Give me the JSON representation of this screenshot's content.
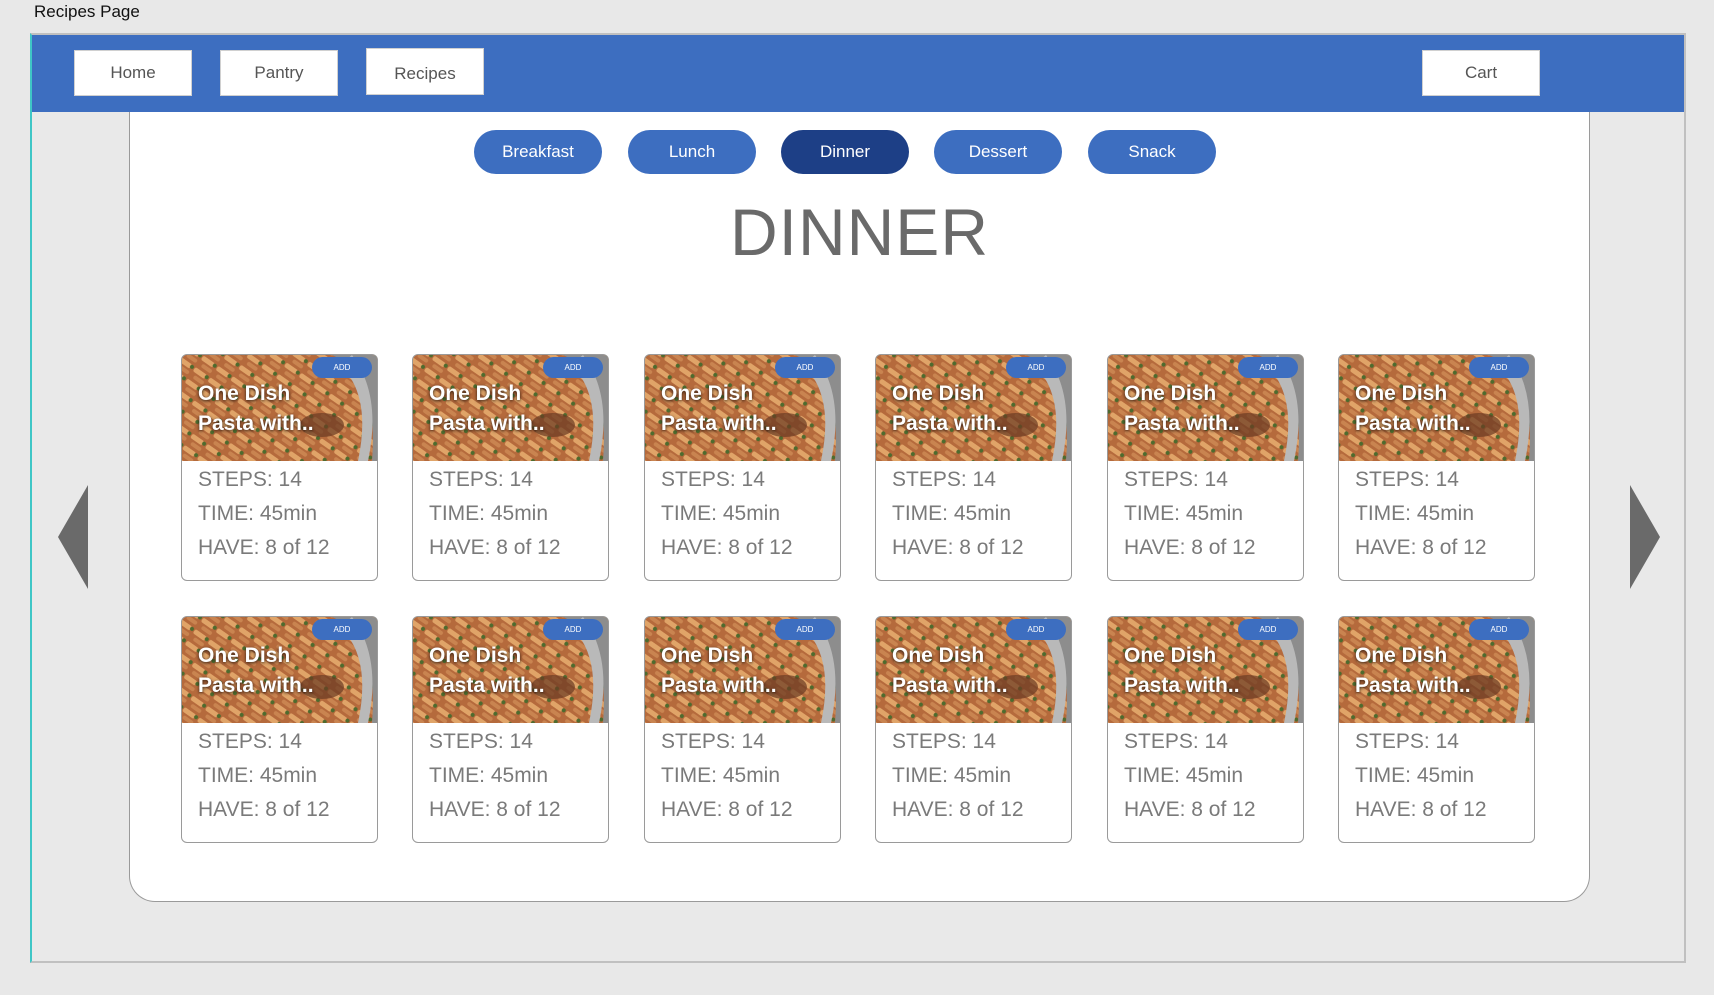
{
  "window": {
    "title": "Recipes Page"
  },
  "nav": {
    "home": "Home",
    "pantry": "Pantry",
    "recipes": "Recipes",
    "cart": "Cart"
  },
  "categories": [
    "Breakfast",
    "Lunch",
    "Dinner",
    "Dessert",
    "Snack"
  ],
  "active_category": "Dinner",
  "heading": "DINNER",
  "cards": [
    {
      "title_line1": "One Dish",
      "title_line2": "Pasta with..",
      "add": "ADD",
      "steps": "STEPS: 14",
      "time": "TIME: 45min",
      "have": "HAVE: 8 of 12"
    },
    {
      "title_line1": "One Dish",
      "title_line2": "Pasta with..",
      "add": "ADD",
      "steps": "STEPS: 14",
      "time": "TIME: 45min",
      "have": "HAVE: 8 of 12"
    },
    {
      "title_line1": "One Dish",
      "title_line2": "Pasta with..",
      "add": "ADD",
      "steps": "STEPS: 14",
      "time": "TIME: 45min",
      "have": "HAVE: 8 of 12"
    },
    {
      "title_line1": "One Dish",
      "title_line2": "Pasta with..",
      "add": "ADD",
      "steps": "STEPS: 14",
      "time": "TIME: 45min",
      "have": "HAVE: 8 of 12"
    },
    {
      "title_line1": "One Dish",
      "title_line2": "Pasta with..",
      "add": "ADD",
      "steps": "STEPS: 14",
      "time": "TIME: 45min",
      "have": "HAVE: 8 of 12"
    },
    {
      "title_line1": "One Dish",
      "title_line2": "Pasta with..",
      "add": "ADD",
      "steps": "STEPS: 14",
      "time": "TIME: 45min",
      "have": "HAVE: 8 of 12"
    },
    {
      "title_line1": "One Dish",
      "title_line2": "Pasta with..",
      "add": "ADD",
      "steps": "STEPS: 14",
      "time": "TIME: 45min",
      "have": "HAVE: 8 of 12"
    },
    {
      "title_line1": "One Dish",
      "title_line2": "Pasta with..",
      "add": "ADD",
      "steps": "STEPS: 14",
      "time": "TIME: 45min",
      "have": "HAVE: 8 of 12"
    },
    {
      "title_line1": "One Dish",
      "title_line2": "Pasta with..",
      "add": "ADD",
      "steps": "STEPS: 14",
      "time": "TIME: 45min",
      "have": "HAVE: 8 of 12"
    },
    {
      "title_line1": "One Dish",
      "title_line2": "Pasta with..",
      "add": "ADD",
      "steps": "STEPS: 14",
      "time": "TIME: 45min",
      "have": "HAVE: 8 of 12"
    },
    {
      "title_line1": "One Dish",
      "title_line2": "Pasta with..",
      "add": "ADD",
      "steps": "STEPS: 14",
      "time": "TIME: 45min",
      "have": "HAVE: 8 of 12"
    },
    {
      "title_line1": "One Dish",
      "title_line2": "Pasta with..",
      "add": "ADD",
      "steps": "STEPS: 14",
      "time": "TIME: 45min",
      "have": "HAVE: 8 of 12"
    }
  ],
  "icons": {
    "prev": "left-arrow-icon",
    "next": "right-arrow-icon"
  },
  "colors": {
    "accent": "#3d6ec0",
    "active": "#1d3f86",
    "text_muted": "#7a7a7a"
  }
}
